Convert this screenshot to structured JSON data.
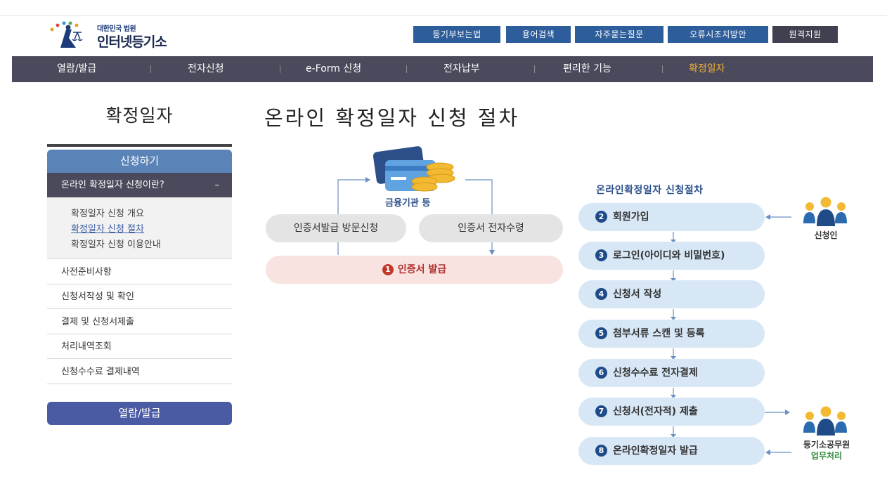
{
  "header": {
    "logo_small": "대한민국 법원",
    "logo_big": "인터넷등기소",
    "util_links": [
      "등기부보는법",
      "용어검색",
      "자주묻는질문",
      "오류시조치방안",
      "원격지원"
    ]
  },
  "gnb": {
    "items": [
      "열람/발급",
      "전자신청",
      "e-Form 신청",
      "전자납부",
      "편리한 기능",
      "확정일자"
    ],
    "active_index": 5
  },
  "side": {
    "title": "확정일자",
    "section_head": "신청하기",
    "sub_head": "온라인 확정일자 신청이란?",
    "sub_head_toggle": "–",
    "sub_links": [
      "확정일자 신청 개요",
      "확정일자 신청 절차",
      "확정일자 신청 이용안내"
    ],
    "items": [
      "사전준비사항",
      "신청서작성 및 확인",
      "결제 및 신청서제출",
      "처리내역조회",
      "신청수수료 결제내역"
    ],
    "bottom_button": "열람/발급"
  },
  "main": {
    "page_title": "온라인 확정일자 신청 절차",
    "left_diagram": {
      "finance_label": "금융기관 등",
      "pill_left": "인증서발급 방문신청",
      "pill_right": "인증서 전자수령",
      "issue_num": "1",
      "issue_label": "인증서 발급"
    },
    "flow": {
      "title": "온라인확정일자 신청절차",
      "steps": [
        {
          "num": "2",
          "label": "회원가입"
        },
        {
          "num": "3",
          "label": "로그인(아이디와 비밀번호)"
        },
        {
          "num": "4",
          "label": "신청서 작성"
        },
        {
          "num": "5",
          "label": "첨부서류 스캔 및 등록"
        },
        {
          "num": "6",
          "label": "신청수수료 전자결제"
        },
        {
          "num": "7",
          "label": "신청서(전자적) 제출"
        },
        {
          "num": "8",
          "label": "온라인확정일자 발급"
        }
      ],
      "applicant_label": "신청인",
      "officer_label": "등기소공무원",
      "officer_sub": "업무처리"
    }
  },
  "colors": {
    "gnb_bg": "#4a4a5c",
    "gnb_active": "#f5b234",
    "util_blue": "#2d5d9a",
    "step_bg": "#d7e7f6",
    "issue_bg": "#f8e3e0"
  }
}
